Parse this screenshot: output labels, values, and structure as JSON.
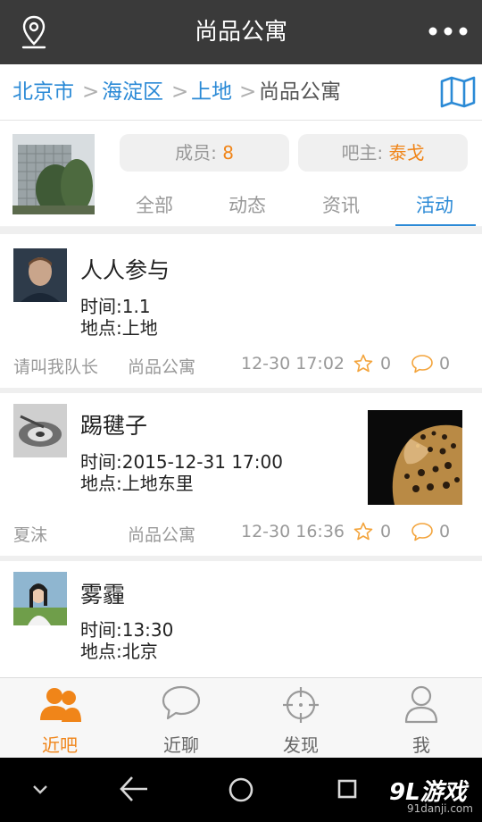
{
  "header": {
    "title": "尚品公寓"
  },
  "breadcrumb": {
    "city": "北京市",
    "district": "海淀区",
    "area": "上地",
    "current": "尚品公寓",
    "sep": ">"
  },
  "group": {
    "members_label": "成员:",
    "members_count": "8",
    "owner_label": "吧主:",
    "owner_name": "泰戈"
  },
  "tabs": [
    {
      "label": "全部"
    },
    {
      "label": "动态"
    },
    {
      "label": "资讯"
    },
    {
      "label": "活动"
    }
  ],
  "posts": [
    {
      "title": "人人参与",
      "time": "时间:1.1",
      "place": "地点:上地",
      "author": "请叫我队长",
      "group": "尚品公寓",
      "date": "12-30 17:02",
      "stars": "0",
      "comments": "0"
    },
    {
      "title": "踢毽子",
      "time": "时间:2015-12-31 17:00",
      "place": "地点:上地东里",
      "author": "夏沫",
      "group": "尚品公寓",
      "date": "12-30 16:36",
      "stars": "0",
      "comments": "0"
    },
    {
      "title": "雾霾",
      "time": "时间:13:30",
      "place": "地点:北京"
    }
  ],
  "bottom_nav": [
    {
      "label": "近吧",
      "icon": "people-icon"
    },
    {
      "label": "近聊",
      "icon": "chat-icon"
    },
    {
      "label": "发现",
      "icon": "crosshair-icon"
    },
    {
      "label": "我",
      "icon": "person-icon"
    }
  ],
  "watermark": {
    "brand": "9L游戏",
    "site": "91danji.com"
  },
  "colors": {
    "accent_blue": "#2b8ad6",
    "accent_orange": "#f08519",
    "topbar": "#3a3a3a"
  }
}
